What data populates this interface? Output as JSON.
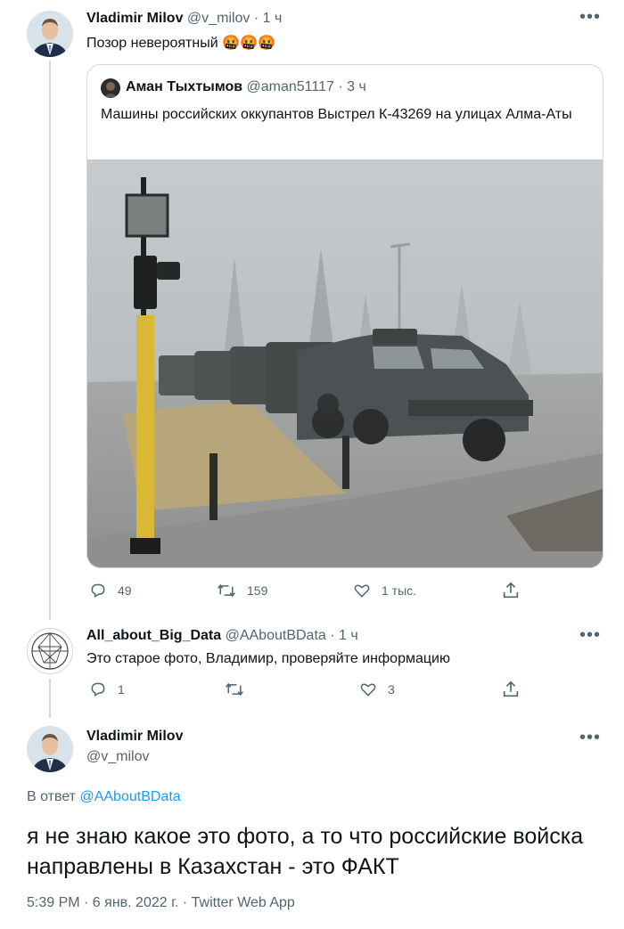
{
  "tweet1": {
    "name": "Vladimir Milov",
    "handle": "@v_milov",
    "time": "· 1 ч",
    "text": "Позор невероятный",
    "emoji": "🤬🤬🤬",
    "more_icon": "more-dots-icon"
  },
  "quote": {
    "name": "Аман Тыхтымов",
    "handle": "@aman51117",
    "time": "· 3 ч",
    "text": "Машины российских оккупантов Выстрел К-43269 на улицах Алма-Аты"
  },
  "tweet1_actions": {
    "replies": "49",
    "retweets": "159",
    "likes": "1 тыс.",
    "share": ""
  },
  "tweet2": {
    "name": "All_about_Big_Data",
    "handle": "@AAboutBData",
    "time": "· 1 ч",
    "text": "Это старое фото, Владимир, проверяйте информацию"
  },
  "tweet2_actions": {
    "replies": "1",
    "retweets": "",
    "likes": "3"
  },
  "tweet3": {
    "name": "Vladimir Milov",
    "handle": "@v_milov",
    "reply_prefix": "В ответ",
    "reply_handle": "@AAboutBData",
    "text": "я не знаю какое это фото, а то что российские войска направлены в Казахстан - это ФАКТ",
    "meta": "5:39 PM · 6 янв. 2022 г. · Twitter Web App"
  },
  "colors": {
    "text": "#0f1419",
    "secondary": "#536471",
    "link": "#1d9bf0",
    "border": "#cfd9de"
  }
}
